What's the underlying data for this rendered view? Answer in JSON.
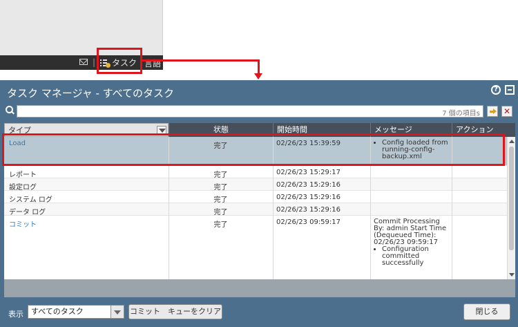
{
  "statusbar": {
    "task_label": "タスク",
    "lang_label": "言語",
    "separator": "|"
  },
  "dialog": {
    "title": "タスク マネージャ - すべてのタスク",
    "help_icon": "?",
    "search": {
      "value": "",
      "count": "7 個の項目s"
    },
    "columns": {
      "type": "タイプ",
      "status": "状態",
      "start": "開始時間",
      "message": "メッセージ",
      "action": "アクション"
    },
    "rows": [
      {
        "type": "Load",
        "status": "完了",
        "start": "02/26/23 15:39:59",
        "message_bullets": [
          "Config loaded from running-config-backup.xml"
        ],
        "message_text": ""
      },
      {
        "type": "レポート",
        "status": "完了",
        "start": "02/26/23 15:29:17",
        "message_text": ""
      },
      {
        "type": "設定ログ",
        "status": "完了",
        "start": "02/26/23 15:29:16",
        "message_text": ""
      },
      {
        "type": "システム ログ",
        "status": "完了",
        "start": "02/26/23 15:29:16",
        "message_text": ""
      },
      {
        "type": "データ ログ",
        "status": "完了",
        "start": "02/26/23 15:29:16",
        "message_text": ""
      },
      {
        "type": "コミット",
        "status": "完了",
        "start": "02/26/23 09:59:17",
        "message_text": "Commit Processing By: admin Start Time (Dequeued Time): 02/26/23 09:59:17",
        "message_bullets": [
          "Configuration committed successfully"
        ]
      }
    ],
    "footer": {
      "show_label": "表示",
      "show_value": "すべてのタスク",
      "commit_queue_button": "コミット　キューをクリア",
      "close_button": "閉じる"
    }
  },
  "colors": {
    "dialog_bg": "#4b6f8c",
    "highlight": "#e0141b",
    "selected_row": "#b7c8d2",
    "link": "#2e7ab8"
  }
}
